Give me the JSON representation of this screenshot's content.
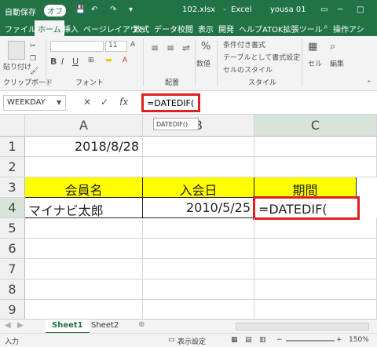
{
  "titlebar": {
    "autosave": "自動保存",
    "autosave_state": "オフ",
    "filename": "102.xlsx",
    "app": "Excel",
    "user": "yousa 01"
  },
  "tabs": [
    "ファイル",
    "ホーム",
    "挿入",
    "ページレイアウト",
    "数式",
    "データ",
    "校閲",
    "表示",
    "開発",
    "ヘルプ",
    "ATOK拡張ツール",
    "操作アシ"
  ],
  "ribbon": {
    "paste": "貼り付け",
    "clipboard": "クリップボード",
    "font_size": "11",
    "font_group": "フォント",
    "align_group": "配置",
    "number": "数値",
    "style_items": [
      "条件付き書式",
      "テーブルとして書式設定",
      "セルのスタイル"
    ],
    "style_group": "スタイル",
    "cell": "セル",
    "edit": "編集"
  },
  "formula": {
    "namebox": "WEEKDAY",
    "text": "=DATEDIF(",
    "tooltip": "DATEDIF()"
  },
  "columns": [
    "A",
    "B",
    "C"
  ],
  "rows": [
    "1",
    "2",
    "3",
    "4",
    "5",
    "6",
    "7",
    "8",
    "9"
  ],
  "cells": {
    "a1": "2018/8/28",
    "a3": "会員名",
    "b3": "入会日",
    "c3": "期間",
    "a4": "マイナビ太郎",
    "b4": "2010/5/25",
    "c4": "=DATEDIF("
  },
  "sheets": [
    "Sheet1",
    "Sheet2"
  ],
  "status": {
    "mode": "入力",
    "display_settings": "表示設定",
    "zoom": "150%"
  },
  "colors": {
    "accent": "#217346",
    "header_fill": "#ffff00",
    "highlight": "#e02020"
  }
}
